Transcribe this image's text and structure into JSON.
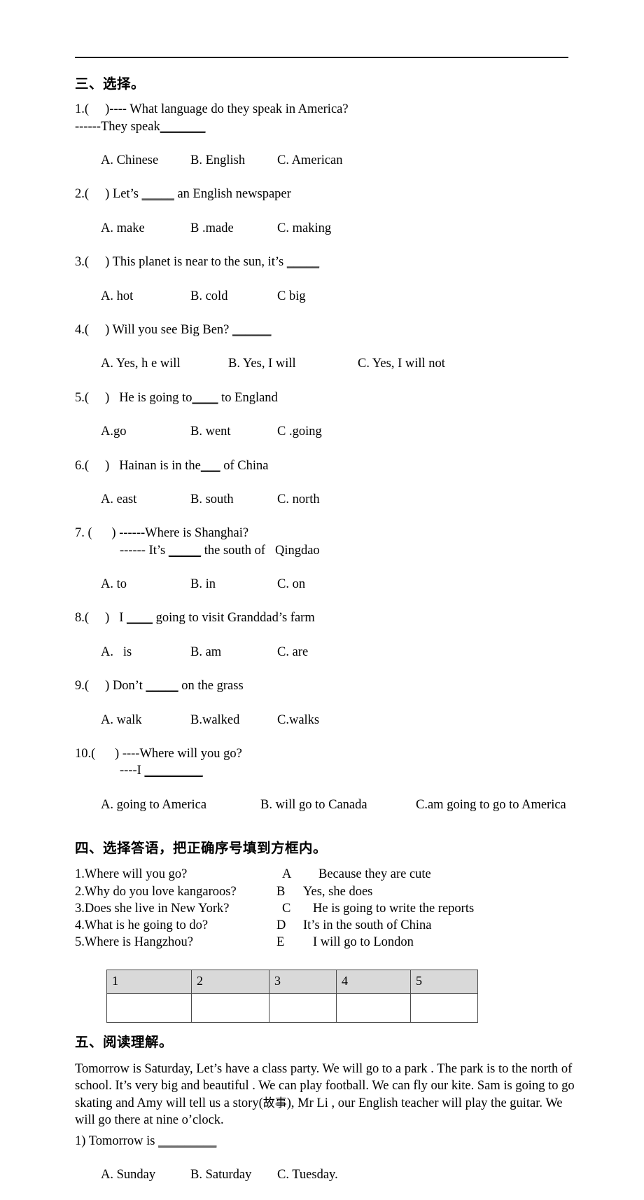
{
  "document": {
    "type": "english-worksheet-page"
  },
  "section3": {
    "heading": "三、选择。",
    "questions": [
      {
        "stem": "1.(     )---- What language do they speak in America?",
        "stem2": "------They speak",
        "blank": "_______",
        "options": [
          "A. Chinese",
          "B. English",
          "C. American"
        ]
      },
      {
        "stem_a": "2.(     ) Let’s ",
        "blank": "_____",
        "stem_b": " an English newspaper",
        "options": [
          "A. make",
          "B .made",
          "C. making"
        ]
      },
      {
        "stem_a": "3.(     ) This planet is near to the sun, it’s ",
        "blank": "_____",
        "stem_b": "",
        "options": [
          "A. hot",
          "B. cold",
          "C big"
        ]
      },
      {
        "stem_a": "4.(     ) Will you see Big Ben? ",
        "blank": "______",
        "stem_b": "",
        "options": [
          "A. Yes, h e will",
          "B. Yes, I will",
          "C. Yes, I will not"
        ]
      },
      {
        "stem_a": "5.(     )   He is going to",
        "blank": "____",
        "stem_b": " to England",
        "options": [
          "A.go",
          "B. went",
          "C .going"
        ]
      },
      {
        "stem_a": "6.(     )   Hainan is in the",
        "blank": "___",
        "stem_b": " of China",
        "options": [
          "A. east",
          "B. south",
          "C. north"
        ]
      },
      {
        "stem": "7. (      ) ------Where is Shanghai?",
        "stem2_a": "------ It’s ",
        "blank2": "_____",
        "stem2_b": " the south of   Qingdao",
        "options": [
          "A. to",
          "B. in",
          "C. on"
        ]
      },
      {
        "stem_a": "8.(     )   I ",
        "blank": "____",
        "stem_b": " going to visit Granddad’s farm",
        "options": [
          "A.   is",
          "B. am",
          "C. are"
        ]
      },
      {
        "stem_a": "9.(     ) Don’t ",
        "blank": "_____",
        "stem_b": " on the grass",
        "options": [
          "A. walk",
          "B.walked",
          "C.walks"
        ]
      },
      {
        "stem": "10.(      ) ----Where will you go?",
        "stem2_a": "----I ",
        "blank2": "_________",
        "stem2_b": "",
        "options": [
          "A. going to America",
          "B. will go to Canada",
          "C.am going to go to America"
        ]
      }
    ]
  },
  "section4": {
    "heading": "四、选择答语，把正确序号填到方框内。",
    "pairs": [
      {
        "question": "1.Where will you go?",
        "letter": "A",
        "answer": "Because they are cute"
      },
      {
        "question": "2.Why do you love kangaroos?",
        "letter": "B",
        "answer": "Yes, she does"
      },
      {
        "question": "3.Does she live in New York?",
        "letter": "C",
        "answer": "He is going to write the reports"
      },
      {
        "question": "4.What is he going to do?",
        "letter": "D",
        "answer": "It’s in the south of China"
      },
      {
        "question": "5.Where is Hangzhou?",
        "letter": "E",
        "answer": "I will go to London"
      }
    ],
    "answer_table": {
      "headers": [
        "1",
        "2",
        "3",
        "4",
        "5"
      ],
      "values": [
        "",
        "",
        "",
        "",
        ""
      ],
      "header_fill": "#d9d9d9",
      "border_color": "#4a4a4a"
    }
  },
  "section5": {
    "heading": "五、阅读理解。",
    "passage_part1": "Tomorrow is Saturday, Let’s have a class party. We will go to a park . The park is to the north of school. It’s very big and beautiful . We can play football. We can fly our kite. Sam is going to go skating and Amy will tell us a story(",
    "passage_cjk": "故事",
    "passage_part2": "), Mr Li    , our English teacher will play the guitar.    We will go there at nine o’clock.",
    "questions": [
      {
        "stem_a": "1) Tomorrow is ",
        "blank": "_________",
        "options": [
          "A. Sunday",
          "B. Saturday",
          "C. Tuesday."
        ]
      }
    ]
  }
}
